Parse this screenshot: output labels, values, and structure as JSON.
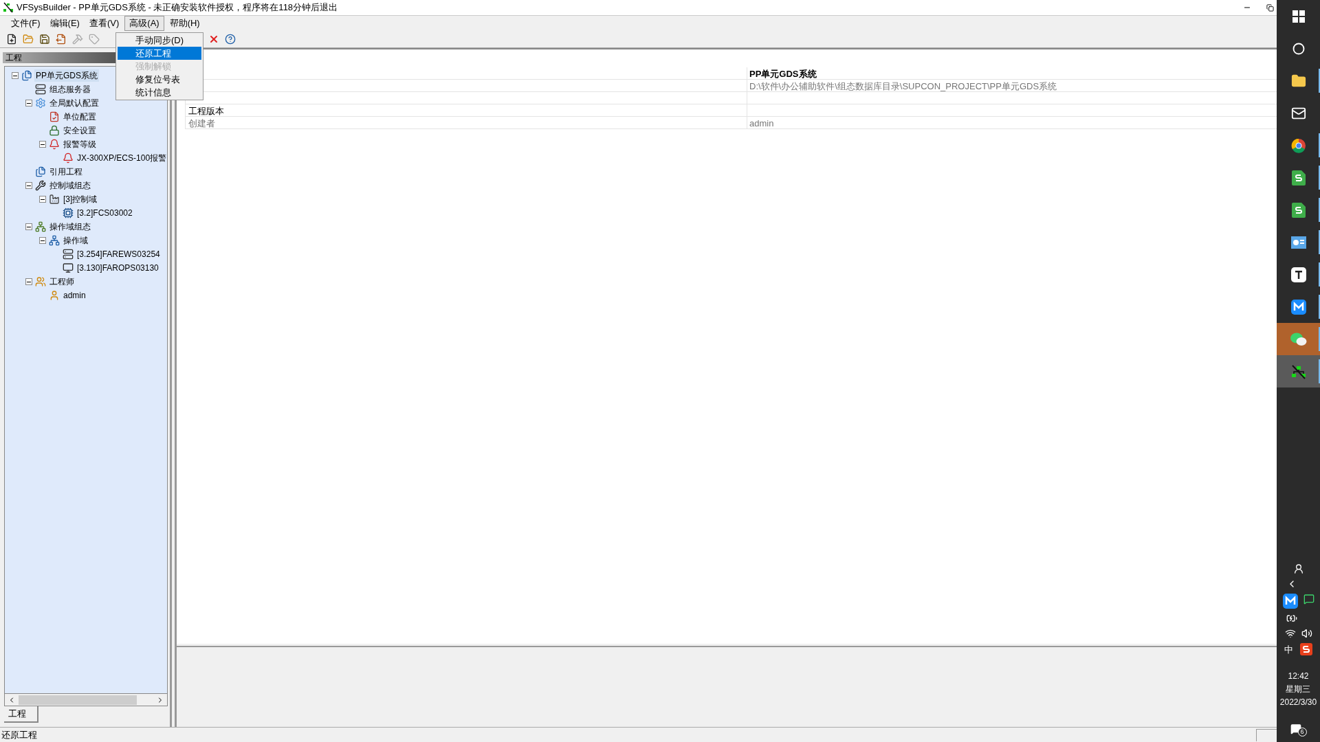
{
  "window": {
    "title": "VFSysBuilder - PP单元GDS系统 - 未正确安装软件授权，程序将在118分钟后退出"
  },
  "menubar": [
    {
      "label": "文件(F)",
      "open": false
    },
    {
      "label": "编辑(E)",
      "open": false
    },
    {
      "label": "查看(V)",
      "open": false
    },
    {
      "label": "高级(A)",
      "open": true
    },
    {
      "label": "帮助(H)",
      "open": false
    }
  ],
  "toolbar": [
    {
      "kind": "new",
      "disabled": false
    },
    {
      "kind": "open",
      "disabled": false
    },
    {
      "kind": "save",
      "disabled": false
    },
    {
      "kind": "export",
      "disabled": false
    },
    {
      "kind": "build",
      "disabled": true
    },
    {
      "kind": "tag",
      "disabled": true
    },
    {
      "kind": "delete",
      "disabled": false
    },
    {
      "kind": "help",
      "disabled": false
    }
  ],
  "dropdown": [
    {
      "label": "手动同步(D)",
      "selected": false,
      "disabled": false
    },
    {
      "label": "还原工程",
      "selected": true,
      "disabled": false
    },
    {
      "label": "强制解锁",
      "selected": false,
      "disabled": true
    },
    {
      "label": "修复位号表",
      "selected": false,
      "disabled": false
    },
    {
      "label": "统计信息",
      "selected": false,
      "disabled": false
    }
  ],
  "left_panel": {
    "title": "工程",
    "tree": [
      {
        "label": "PP单元GDS系统",
        "kind": "project",
        "expanded": true,
        "selected": true,
        "children": [
          {
            "label": "组态服务器",
            "kind": "server",
            "selected": false
          },
          {
            "label": "全局默认配置",
            "kind": "gear",
            "expanded": true,
            "selected": false,
            "children": [
              {
                "label": "单位配置",
                "kind": "unit",
                "selected": false
              },
              {
                "label": "安全设置",
                "kind": "lock",
                "selected": false
              },
              {
                "label": "报警等级",
                "kind": "alarm",
                "expanded": true,
                "selected": false,
                "children": [
                  {
                    "label": "JX-300XP/ECS-100报警",
                    "kind": "alarm",
                    "selected": false
                  }
                ]
              }
            ]
          },
          {
            "label": "引用工程",
            "kind": "project",
            "selected": false
          },
          {
            "label": "控制域组态",
            "kind": "tools",
            "expanded": true,
            "selected": false,
            "children": [
              {
                "label": "[3]控制域",
                "kind": "factory",
                "expanded": true,
                "selected": false,
                "children": [
                  {
                    "label": "[3.2]FCS03002",
                    "kind": "controller",
                    "selected": false
                  }
                ]
              }
            ]
          },
          {
            "label": "操作域组态",
            "kind": "station",
            "expanded": true,
            "selected": false,
            "children": [
              {
                "label": "操作域",
                "kind": "network",
                "expanded": true,
                "selected": false,
                "children": [
                  {
                    "label": "[3.254]FAREWS03254",
                    "kind": "server",
                    "selected": false
                  },
                  {
                    "label": "[3.130]FAROPS03130",
                    "kind": "computer",
                    "selected": false
                  }
                ]
              }
            ]
          },
          {
            "label": "工程师",
            "kind": "users",
            "expanded": true,
            "selected": false,
            "children": [
              {
                "label": "admin",
                "kind": "user",
                "selected": false
              }
            ]
          }
        ]
      }
    ],
    "tabs": [
      {
        "label": "工程",
        "selected": true
      }
    ]
  },
  "properties": [
    {
      "kind": "entry",
      "value": "PP单元GDS系统",
      "bold": true
    },
    {
      "kind": "entry",
      "value": "D:\\软件\\办公辅助软件\\组态数据库目录\\SUPCON_PROJECT\\PP单元GDS系统",
      "bold": false
    },
    {
      "kind": "blank"
    },
    {
      "kind": "entry",
      "name": "工程版本"
    },
    {
      "kind": "entry",
      "name": "创建者",
      "value": "admin",
      "bold": false
    }
  ],
  "status_bar": {
    "text": "还原工程"
  },
  "taskbar": {
    "apps": [
      {
        "kind": "search"
      },
      {
        "kind": "taskview"
      },
      {
        "kind": "folder",
        "running": true
      },
      {
        "kind": "mail",
        "running": false
      },
      {
        "kind": "chrome",
        "running": true
      },
      {
        "kind": "sheet",
        "running": true
      },
      {
        "kind": "sheet",
        "running": true
      },
      {
        "kind": "presentation",
        "running": true
      },
      {
        "kind": "text",
        "running": true
      },
      {
        "kind": "messenger",
        "running": true
      },
      {
        "kind": "chat",
        "running": true,
        "flashing": true,
        "active": false
      },
      {
        "kind": "builder",
        "running": true,
        "active": true,
        "flashing": false
      }
    ],
    "tray": {
      "ime": "中",
      "time": "12:42",
      "weekday": "星期三",
      "date": "2022/3/30",
      "notifications": "6"
    }
  }
}
